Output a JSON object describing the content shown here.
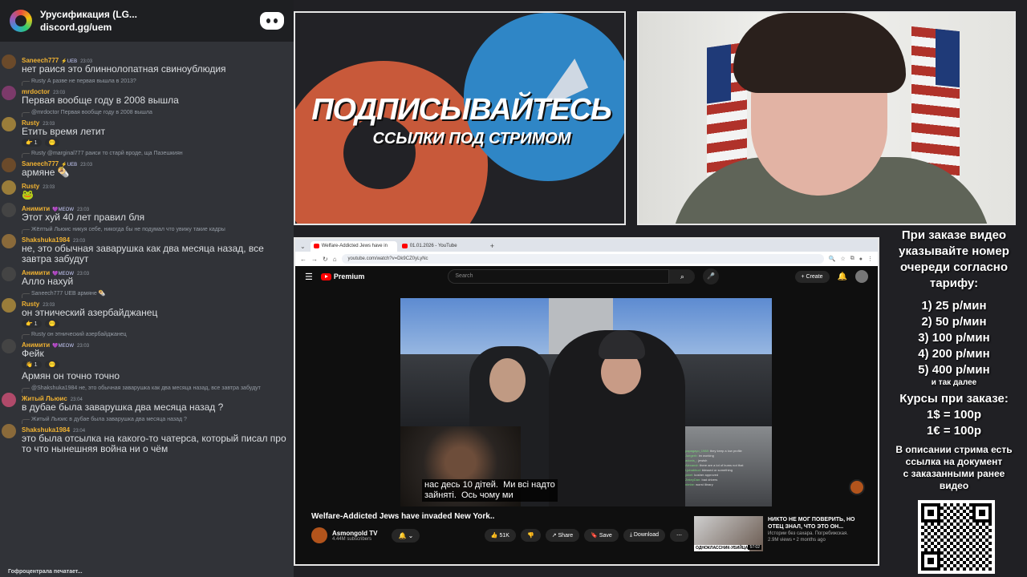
{
  "discord": {
    "server_name": "Урусификация (LG...",
    "server_link": "discord.gg/uem",
    "typing": "Гофроцентрала печатает...",
    "messages": [
      {
        "user": "Saneech777",
        "color": "#f0b232",
        "badge": "⚡UEB",
        "time": "23:03",
        "text": "нет раися это блиннолопатная свиноублюдия",
        "avatar": "#6b4a2a"
      },
      {
        "reply": "Rusty А разве не первая вышла в 2013?",
        "user": "mrdoctor",
        "color": "#f0b232",
        "badge": "",
        "time": "23:03",
        "text": "Первая вообще году в 2008 вышла",
        "avatar": "#7c3a6a"
      },
      {
        "reply": "@mrdoctor Первая вообще году в 2008 вышла",
        "user": "Rusty",
        "color": "#f0b232",
        "badge": "",
        "time": "23:03",
        "text": "Етить время летит",
        "avatar": "#9a7d3a",
        "reacts": [
          "👉 1",
          "😶"
        ]
      },
      {
        "reply": "Rusty @marginal777 раиси то старй вроде, ща Пазешкиян",
        "user": "Saneech777",
        "color": "#f0b232",
        "badge": "⚡UEB",
        "time": "23:03",
        "text": "армяне 🌯",
        "avatar": "#6b4a2a"
      },
      {
        "user": "Rusty",
        "color": "#f0b232",
        "badge": "",
        "time": "23:03",
        "text": "🐸",
        "avatar": "#9a7d3a"
      },
      {
        "user": "Анимити",
        "color": "#f0b232",
        "badge": "💜MEOW",
        "time": "23:03",
        "text": "Этот хуй 40 лет правил бля",
        "avatar": "#444"
      },
      {
        "reply": "Жёлтый Льюис никуя себе, никогда бы не подумал что увижу такие кадры",
        "user": "Shakshuka1984",
        "color": "#f0b232",
        "badge": "",
        "time": "23:03",
        "text": "не, это обычная заварушка как два месяца назад, все завтра забудут",
        "avatar": "#8a6a3a"
      },
      {
        "user": "Анимити",
        "color": "#f0b232",
        "badge": "💜MEOW",
        "time": "23:03",
        "text": "Алло нахуй",
        "avatar": "#444"
      },
      {
        "reply": "Saneech777 UEB армяне 🌯",
        "user": "Rusty",
        "color": "#f0b232",
        "badge": "",
        "time": "23:03",
        "text": "он этнический азербайджанец",
        "avatar": "#9a7d3a",
        "reacts": [
          "👉 1",
          "😶"
        ]
      },
      {
        "reply": "Rusty он этнический азербайджанец",
        "user": "Анимити",
        "color": "#f0b232",
        "badge": "💜MEOW",
        "time": "23:03",
        "text": "Фейк",
        "avatar": "#444",
        "reacts": [
          "👋 1",
          "😶"
        ]
      },
      {
        "user": "",
        "color": "#f0b232",
        "badge": "",
        "time": "",
        "text": "Армян он точно точно",
        "avatar": ""
      },
      {
        "reply": "@Shakshuka1984 не, это обычная заварушка как два месяца назад, все завтра забудут",
        "user": "Житый Льюис",
        "color": "#f0b232",
        "badge": "",
        "time": "23:04",
        "text": "в дубае была заварушка два месяца назад ?",
        "avatar": "#b04a6a"
      },
      {
        "reply": "Житый Льюис в дубае была заварушка два месяца назад ?",
        "user": "Shakshuka1984",
        "color": "#f0b232",
        "badge": "",
        "time": "23:04",
        "text": "это была отсылка на какого-то чатерса, который писал про то что нынешняя война ни о чём",
        "avatar": "#8a6a3a"
      }
    ]
  },
  "promo": {
    "title": "ПОДПИСЫВАЙТЕСЬ",
    "subtitle": "ССЫЛКИ ПОД СТРИМОМ"
  },
  "browser": {
    "tabs": [
      {
        "label": "Welfare-Addicted Jews have in",
        "active": true
      },
      {
        "label": "01.01.2026 - YouTube",
        "active": false
      }
    ],
    "url": "youtube.com/watch?v=Dk9CZ0yLyNc",
    "youtube": {
      "brand": "Premium",
      "search_placeholder": "Search",
      "create_label": "+ Create",
      "subtitle_text": "нас десь 10 дітей.  Ми всі надто\nзайняті.  Ось чому ми",
      "video_title": "Welfare-Addicted Jews have invaded New York..",
      "channel_name": "Asmongold TV",
      "channel_subs": "4.44M subscribers",
      "subscribe_label": "🔔 ⌄",
      "likes": "👍 51K",
      "dislike": "👎",
      "share": "↗ Share",
      "save": "🔖 Save",
      "download": "⤓ Download",
      "more": "⋯",
      "rec_title": "НИКТО НЕ МОГ ПОВЕРИТЬ, НО ОТЕЦ ЗНАЛ, ЧТО ЭТО ОН...",
      "rec_channel": "Истории без сахара. Погребижская.",
      "rec_meta": "2.9M views • 2 months ago",
      "rec_label": "ОДНОКЛАССНИК-УБИЙЦА",
      "rec_time": "57:02",
      "overlay_chat": [
        {
          "n": "papagayo_1988:",
          "t": "they keep a low profile"
        },
        {
          "n": "Jaegerb:",
          "t": "im working"
        },
        {
          "n": "adonis_:",
          "t": "jewish"
        },
        {
          "n": "Alexandr:",
          "t": "there are a lot of bums not that"
        },
        {
          "n": "Ljubabhud:",
          "t": "blessed or something"
        },
        {
          "n": "ykkel:",
          "t": "kosher approved"
        },
        {
          "n": "ZekeyDan:",
          "t": "bad drivers"
        },
        {
          "n": "nimbe:",
          "t": "worst library"
        }
      ]
    }
  },
  "info_panel": {
    "lines_top": [
      "При заказе видео",
      "указывайте номер",
      "очереди согласно",
      "тарифу:"
    ],
    "tariffs": [
      "1) 25 р/мин",
      "2) 50 р/мин",
      "3) 100 р/мин",
      "4) 200 р/мин",
      "5) 400 р/мин"
    ],
    "etc": "и так далее",
    "rates_title": "Курсы при заказе:",
    "rates": [
      "1$ = 100р",
      "1€ = 100р"
    ],
    "desc": [
      "В описании стрима есть",
      "ссылка на документ",
      "с заказанными ранее",
      "видео"
    ]
  }
}
